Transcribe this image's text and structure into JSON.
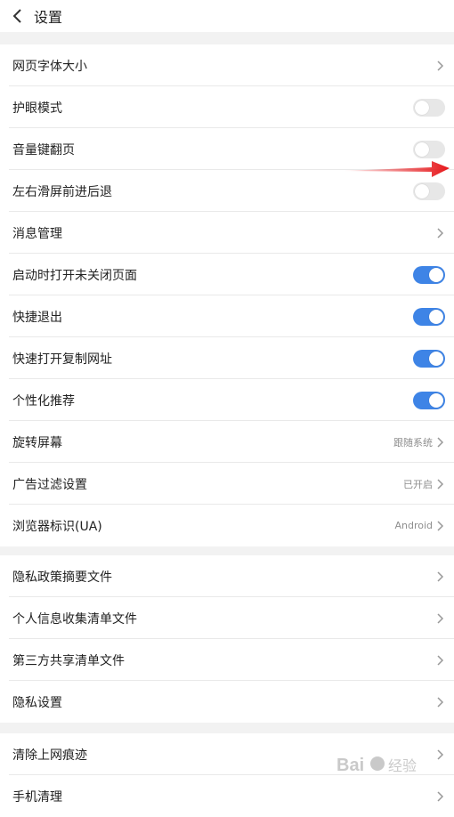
{
  "header": {
    "title": "设置",
    "back_icon": "chevron-left-icon"
  },
  "colors": {
    "accent": "#3e84e6",
    "background": "#f2f2f2",
    "annotation": "#e6161a"
  },
  "section1": {
    "items": [
      {
        "label": "网页字体大小",
        "type": "link"
      },
      {
        "label": "护眼模式",
        "type": "toggle",
        "on": false
      },
      {
        "label": "音量键翻页",
        "type": "toggle",
        "on": false
      },
      {
        "label": "左右滑屏前进后退",
        "type": "toggle",
        "on": false
      },
      {
        "label": "消息管理",
        "type": "link"
      },
      {
        "label": "启动时打开未关闭页面",
        "type": "toggle",
        "on": true
      },
      {
        "label": "快捷退出",
        "type": "toggle",
        "on": true
      },
      {
        "label": "快速打开复制网址",
        "type": "toggle",
        "on": true
      },
      {
        "label": "个性化推荐",
        "type": "toggle",
        "on": true
      },
      {
        "label": "旋转屏幕",
        "type": "link",
        "value": "跟随系统"
      },
      {
        "label": "广告过滤设置",
        "type": "link",
        "value": "已开启"
      },
      {
        "label": "浏览器标识(UA)",
        "type": "link",
        "value": "Android"
      }
    ]
  },
  "section2": {
    "items": [
      {
        "label": "隐私政策摘要文件",
        "type": "link"
      },
      {
        "label": "个人信息收集清单文件",
        "type": "link"
      },
      {
        "label": "第三方共享清单文件",
        "type": "link"
      },
      {
        "label": "隐私设置",
        "type": "link"
      }
    ]
  },
  "section3": {
    "items": [
      {
        "label": "清除上网痕迹",
        "type": "link"
      },
      {
        "label": "手机清理",
        "type": "link"
      }
    ]
  },
  "watermark": {
    "text": "Baidu 经验"
  }
}
